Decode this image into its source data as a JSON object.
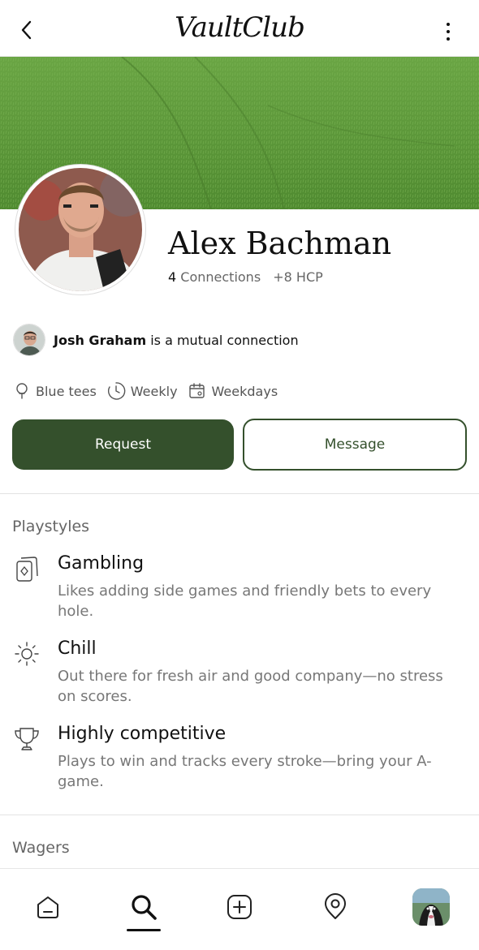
{
  "app": {
    "logo_text": "VaultClub"
  },
  "profile": {
    "name": "Alex Bachman",
    "connections_count": "4",
    "connections_label": "Connections",
    "handicap": "+8 HCP"
  },
  "mutual": {
    "name": "Josh Graham",
    "suffix": "is a mutual connection"
  },
  "preferences": [
    {
      "icon": "tee-icon",
      "label": "Blue tees"
    },
    {
      "icon": "clock-icon",
      "label": "Weekly"
    },
    {
      "icon": "calendar-icon",
      "label": "Weekdays"
    }
  ],
  "actions": {
    "request_label": "Request",
    "message_label": "Message"
  },
  "playstyles": {
    "title": "Playstyles",
    "items": [
      {
        "icon": "cards-icon",
        "name": "Gambling",
        "description": "Likes adding side games and friendly bets to every hole."
      },
      {
        "icon": "sun-icon",
        "name": "Chill",
        "description": "Out there for fresh air and good company—no stress on scores."
      },
      {
        "icon": "trophy-icon",
        "name": "Highly competitive",
        "description": "Plays to win and tracks every stroke—bring your A-game."
      }
    ]
  },
  "wagers": {
    "title": "Wagers"
  },
  "nav": {
    "items": [
      "home-icon",
      "search-icon",
      "add-icon",
      "location-icon",
      "profile-avatar"
    ],
    "active": "search-icon"
  },
  "colors": {
    "accent": "#34502c",
    "grass": "#5f9a3c"
  }
}
